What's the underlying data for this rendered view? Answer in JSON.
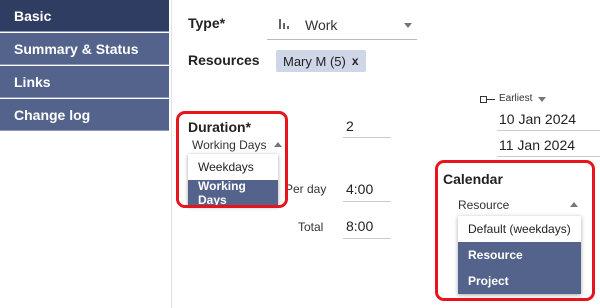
{
  "sidebar": {
    "items": [
      {
        "label": "Basic",
        "active": true
      },
      {
        "label": "Summary & Status"
      },
      {
        "label": "Links"
      },
      {
        "label": "Change log"
      }
    ]
  },
  "type": {
    "label": "Type*",
    "value": "Work",
    "icon": "bar-chart-icon"
  },
  "resources": {
    "label": "Resources",
    "chip": "Mary M (5)",
    "chip_remove": "x"
  },
  "duration": {
    "label": "Duration*",
    "value": "2",
    "unit_selected": "Working Days",
    "options": [
      "Weekdays",
      "Working Days"
    ],
    "selected_option": "Working Days"
  },
  "per_day": {
    "label": "Per day",
    "value": "4:00"
  },
  "total": {
    "label": "Total",
    "value": "8:00"
  },
  "constraint": {
    "label": "Earliest",
    "start_date": "10 Jan 2024",
    "end_date": "11 Jan 2024"
  },
  "calendar": {
    "label": "Calendar",
    "selected": "Resource",
    "options": [
      "Default (weekdays)",
      "Resource",
      "Project"
    ]
  },
  "colors": {
    "nav": "#54638c",
    "nav_active": "#2f3d63",
    "highlight": "#e8141c",
    "selected": "#54638c"
  }
}
